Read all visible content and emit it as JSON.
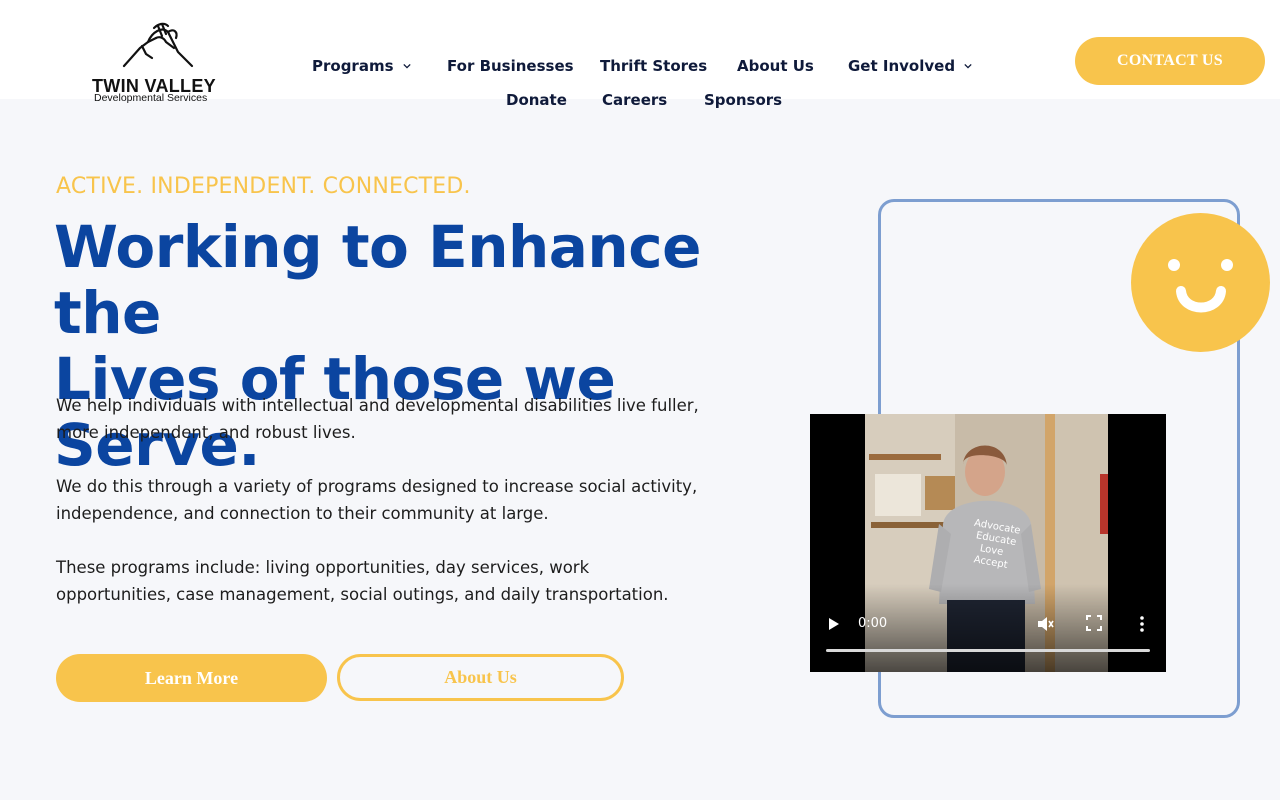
{
  "brand": {
    "name": "TWIN VALLEY",
    "tagline": "Developmental Services"
  },
  "nav": {
    "items": [
      {
        "label": "Programs",
        "has_dropdown": true
      },
      {
        "label": "For Businesses",
        "has_dropdown": false
      },
      {
        "label": "Thrift Stores",
        "has_dropdown": false
      },
      {
        "label": "About Us",
        "has_dropdown": false
      },
      {
        "label": "Get Involved",
        "has_dropdown": true
      },
      {
        "label": "Donate",
        "has_dropdown": false
      },
      {
        "label": "Careers",
        "has_dropdown": false
      },
      {
        "label": "Sponsors",
        "has_dropdown": false
      }
    ],
    "contact_label": "CONTACT US"
  },
  "hero": {
    "eyebrow": "ACTIVE. INDEPENDENT. CONNECTED.",
    "headline_line1": "Working to Enhance the",
    "headline_line2": "Lives of those we Serve.",
    "paragraphs": [
      "We help individuals with intellectual and developmental disabilities live fuller, more independent, and robust lives.",
      "We do this through a variety of programs designed to increase social activity, independence, and connection to their community at large.",
      "These programs include: living opportunities, day services, work opportunities, case management, social outings, and daily transportation."
    ],
    "primary_button": "Learn More",
    "secondary_button": "About Us"
  },
  "video": {
    "time": "0:00",
    "shirt_text": [
      "Advocate",
      "Educate",
      "Love",
      "Accept"
    ]
  },
  "colors": {
    "accent_yellow": "#f8c44c",
    "heading_blue": "#0b45a0",
    "frame_blue": "#7d9ed0",
    "nav_text": "#0f1a3a",
    "page_bg": "#f6f7fa"
  },
  "icons": {
    "dropdown": "chevron-down-icon",
    "logo": "handshake-icon",
    "decoration": "smiley-icon",
    "play": "play-icon",
    "mute": "mute-icon",
    "fullscreen": "fullscreen-icon",
    "more": "more-vertical-icon"
  }
}
